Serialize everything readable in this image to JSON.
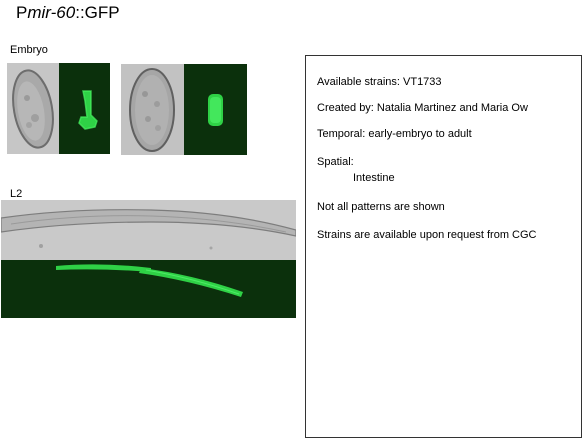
{
  "title": {
    "prefix": "P",
    "gene": "mir-60",
    "suffix": "::GFP"
  },
  "sections": {
    "embryo_label": "Embryo",
    "l2_label": "L2"
  },
  "info": {
    "available_strains": "Available strains: VT1733",
    "created_by": "Created by: Natalia Martinez and Maria Ow",
    "temporal": "Temporal: early-embryo to adult",
    "spatial_label": "Spatial:",
    "spatial_value": "Intestine",
    "note_patterns": "Not all patterns are shown",
    "note_cgc": "Strains are available upon request from CGC"
  },
  "colors": {
    "gfp_background": "#0b300c",
    "gfp_signal": "#33e04a",
    "dic_background": "#c4c4c4"
  }
}
